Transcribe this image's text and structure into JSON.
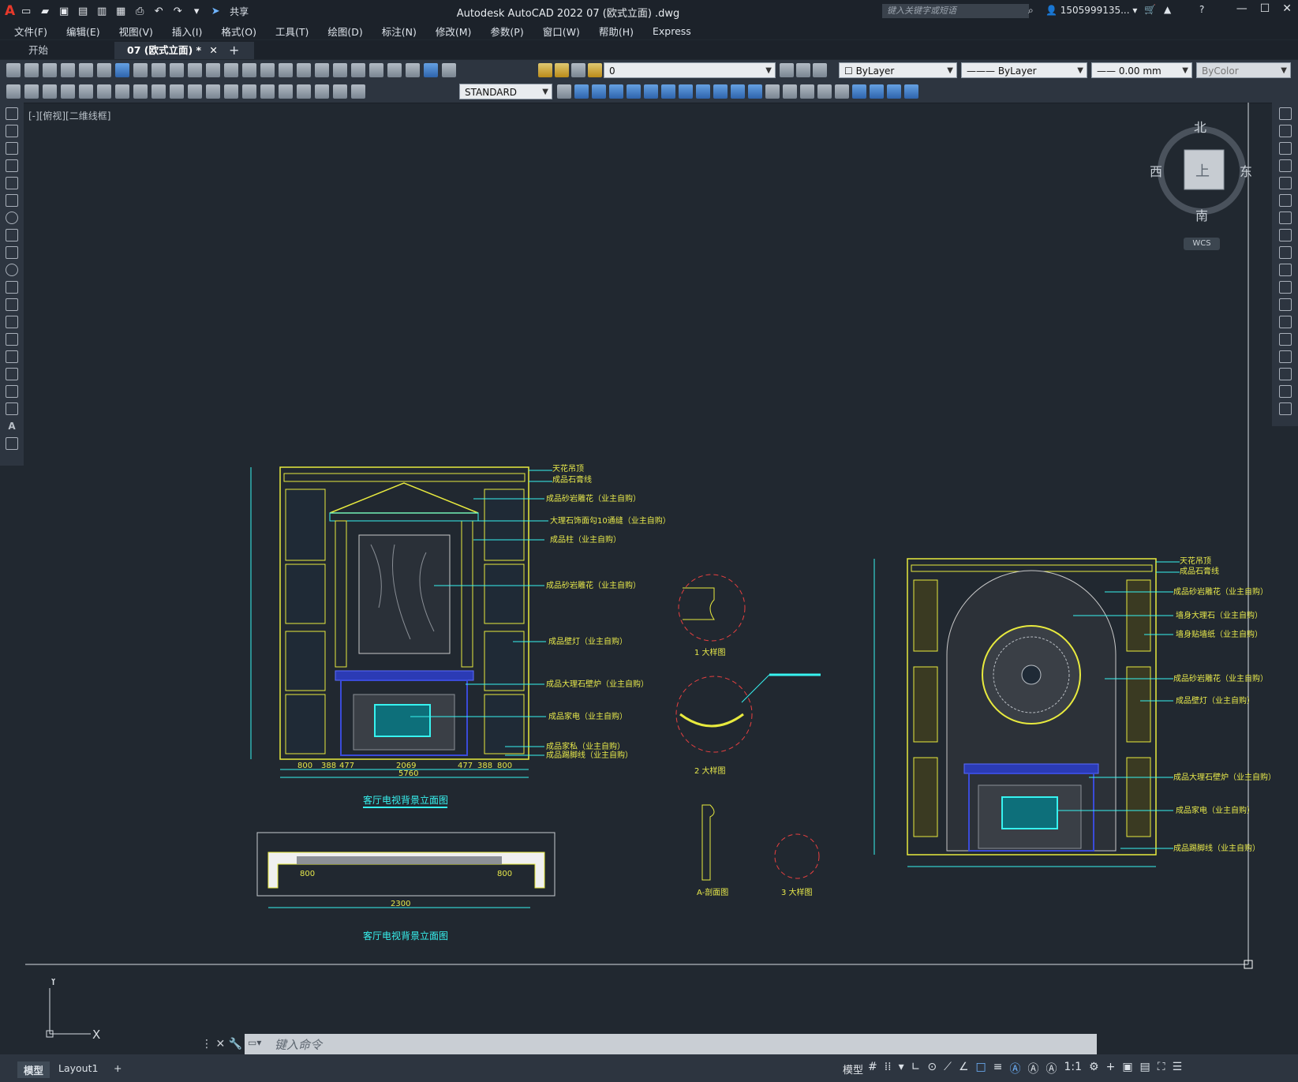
{
  "app": {
    "logo": "A",
    "share_label": "共享",
    "title": "Autodesk AutoCAD 2022    07 (欧式立面) .dwg",
    "search_placeholder": "键入关键字或短语",
    "user": "1505999135..."
  },
  "menu": [
    "文件(F)",
    "编辑(E)",
    "视图(V)",
    "插入(I)",
    "格式(O)",
    "工具(T)",
    "绘图(D)",
    "标注(N)",
    "修改(M)",
    "参数(P)",
    "窗口(W)",
    "帮助(H)",
    "Express"
  ],
  "tabs": [
    {
      "label": "开始",
      "active": false
    },
    {
      "label": "07 (欧式立面) *",
      "active": true
    }
  ],
  "toolbar": {
    "layer_value": "0",
    "color_value": "ByLayer",
    "linetype_value": "ByLayer",
    "lineweight_value": "0.00 mm",
    "plotstyle_value": "ByColor",
    "textstyle_value": "STANDARD"
  },
  "viewport": {
    "label": "[-][俯视][二维线框]",
    "compass": {
      "north": "北",
      "south": "南",
      "east": "东",
      "west": "西",
      "top": "上"
    },
    "wcs": "WCS"
  },
  "drawing": {
    "left_labels": [
      "天花吊顶",
      "成品石膏线",
      "成品砂岩雕花（业主自购）",
      "大理石饰面勾10通缝（业主自购）",
      "成品柱（业主自购）",
      "成品砂岩雕花（业主自购）",
      "成品壁灯（业主自购）",
      "成品大理石壁炉（业主自购）",
      "成品家电（业主自购）",
      "成品家私（业主自购）",
      "成品踢脚线（业主自购）"
    ],
    "right_labels": [
      "天花吊顶",
      "成品石膏线",
      "成品砂岩雕花（业主自购）",
      "墙身大理石（业主自购）",
      "墙身贴墙纸（业主自购）",
      "成品砂岩雕花（业主自购）",
      "成品壁灯（业主自购）",
      "成品大理石壁炉（业主自购）",
      "成品家电（业主自购）",
      "成品踢脚线（业主自购）"
    ],
    "title_elevation": "客厅电视背景立面图",
    "title_plan": "客厅电视背景立面图",
    "detail_1": "1 大样图",
    "detail_2": "2 大样图",
    "detail_3": "3 大样图",
    "detail_a": "A-剖面图",
    "dims_bottom": [
      "800",
      "388",
      "477",
      "2069",
      "477",
      "388",
      "800"
    ],
    "dim_total": "5760",
    "plan_dims": [
      "800",
      "2300",
      "800"
    ]
  },
  "command": {
    "placeholder": "键入命令"
  },
  "status": {
    "tabs": [
      {
        "label": "模型",
        "active": true
      },
      {
        "label": "Layout1",
        "active": false
      }
    ],
    "add": "+",
    "model": "模型",
    "scale": "1:1"
  }
}
